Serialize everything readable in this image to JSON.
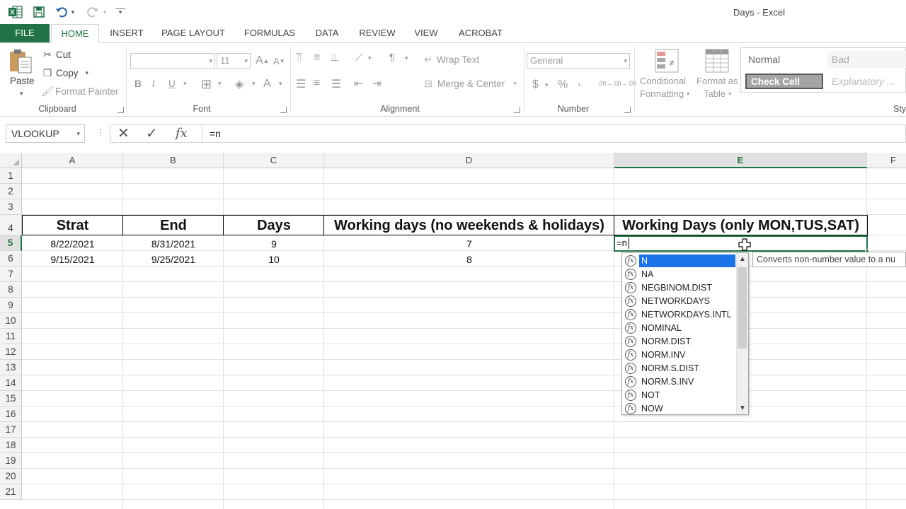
{
  "window": {
    "title": "Days - Excel"
  },
  "qat": {
    "undo_arrow": "▾",
    "redo_arrow": "▾",
    "customize": "▾"
  },
  "tabs": [
    "FILE",
    "HOME",
    "INSERT",
    "PAGE LAYOUT",
    "FORMULAS",
    "DATA",
    "REVIEW",
    "VIEW",
    "ACROBAT"
  ],
  "active_tab": "HOME",
  "ribbon": {
    "clipboard": {
      "paste": "Paste",
      "cut": "Cut",
      "copy": "Copy",
      "format_painter": "Format Painter",
      "label": "Clipboard"
    },
    "font": {
      "size": "11",
      "bold": "B",
      "italic": "I",
      "underline": "U",
      "grow": "A",
      "shrink": "A",
      "color": "A",
      "label": "Font"
    },
    "alignment": {
      "wrap_text": "Wrap Text",
      "merge_center": "Merge & Center",
      "label": "Alignment"
    },
    "number": {
      "format": "General",
      "currency": "$",
      "percent": "%",
      "comma": ",",
      "inc_decimal": ".00→.0",
      "dec_decimal": ".0→.00",
      "label": "Number"
    },
    "styles": {
      "conditional_formatting_1": "Conditional",
      "conditional_formatting_2": "Formatting",
      "format_as_table_1": "Format as",
      "format_as_table_2": "Table",
      "normal": "Normal",
      "bad": "Bad",
      "check_cell": "Check Cell",
      "explanatory": "Explanatory ...",
      "label": "Sty"
    }
  },
  "formula_bar": {
    "name_box": "VLOOKUP",
    "cancel": "✕",
    "enter": "✓",
    "fx": "fx",
    "formula": "=n"
  },
  "columns": [
    "A",
    "B",
    "C",
    "D",
    "E",
    "F"
  ],
  "selected_column": "E",
  "rows": [
    "1",
    "2",
    "3",
    "4",
    "5",
    "6",
    "7",
    "8",
    "9",
    "10",
    "11",
    "12",
    "13",
    "14",
    "15",
    "16",
    "17",
    "18",
    "19",
    "20",
    "21"
  ],
  "selected_row": "5",
  "sheet": {
    "headers": [
      "Strat",
      "End",
      "Days",
      "Working days (no weekends & holidays)",
      "Working Days (only MON,TUS,SAT)"
    ],
    "row5": [
      "8/22/2021",
      "8/31/2021",
      "9",
      "7"
    ],
    "row6": [
      "9/15/2021",
      "9/25/2021",
      "10",
      "8"
    ],
    "active_cell_text": "=n"
  },
  "autocomplete": {
    "items": [
      "N",
      "NA",
      "NEGBINOM.DIST",
      "NETWORKDAYS",
      "NETWORKDAYS.INTL",
      "NOMINAL",
      "NORM.DIST",
      "NORM.INV",
      "NORM.S.DIST",
      "NORM.S.INV",
      "NOT",
      "NOW"
    ],
    "selected_index": 0,
    "tooltip": "Converts non-number value to a nu"
  },
  "colors": {
    "excel_green": "#217346",
    "selection_blue": "#1a73e8"
  }
}
